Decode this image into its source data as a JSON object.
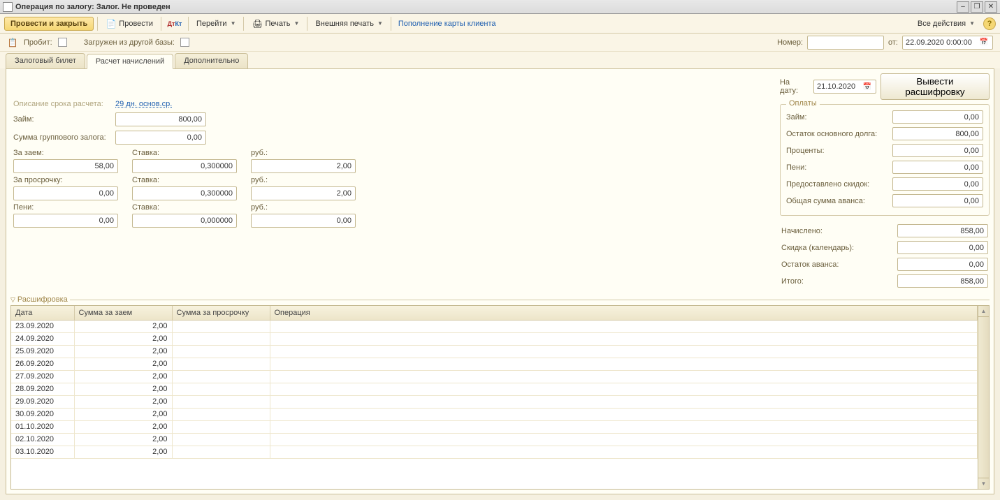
{
  "title": "Операция по залогу: Залог. Не проведен",
  "toolbar": {
    "submit": "Провести и закрыть",
    "post": "Провести",
    "goto": "Перейти",
    "print": "Печать",
    "extprint": "Внешняя печать",
    "cardtopup": "Пополнение карты клиента",
    "allactions": "Все действия"
  },
  "infobar": {
    "probit": "Пробит:",
    "loaded": "Загружен из другой базы:",
    "number_lbl": "Номер:",
    "number_val": "",
    "from_lbl": "от:",
    "from_val": "22.09.2020 0:00:00"
  },
  "tabs": {
    "t1": "Залоговый билет",
    "t2": "Расчет начислений",
    "t3": "Дополнительно"
  },
  "left": {
    "desc_lbl": "Описание срока расчета:",
    "desc_link": "29 дн. основ.ср.",
    "loan_lbl": "Займ:",
    "loan_v": "800,00",
    "group_lbl": "Сумма группового залога:",
    "group_v": "0,00",
    "for_loan": "За заем:",
    "rate": "Ставка:",
    "rub": "руб.:",
    "for_loan_v": "58,00",
    "for_loan_rate": "0,300000",
    "for_loan_rub": "2,00",
    "overdue": "За просрочку:",
    "overdue_v": "0,00",
    "overdue_rate": "0,300000",
    "overdue_rub": "2,00",
    "peni": "Пени:",
    "peni_v": "0,00",
    "peni_rate": "0,000000",
    "peni_rub": "0,00"
  },
  "right": {
    "ondate_lbl": "На дату:",
    "ondate_v": "21.10.2020",
    "decode_btn": "Вывести расшифровку",
    "payments_legend": "Оплаты",
    "p_loan": "Займ:",
    "p_loan_v": "0,00",
    "p_debt": "Остаток основного долга:",
    "p_debt_v": "800,00",
    "p_interest": "Проценты:",
    "p_interest_v": "0,00",
    "p_peni": "Пени:",
    "p_peni_v": "0,00",
    "p_discount": "Предоставлено скидок:",
    "p_discount_v": "0,00",
    "p_advance": "Общая сумма аванса:",
    "p_advance_v": "0,00",
    "t_accrued": "Начислено:",
    "t_accrued_v": "858,00",
    "t_caldisc": "Скидка (календарь):",
    "t_caldisc_v": "0,00",
    "t_advrest": "Остаток аванса:",
    "t_advrest_v": "0,00",
    "t_total": "Итого:",
    "t_total_v": "858,00"
  },
  "detail": {
    "legend": "Расшифровка",
    "cols": {
      "date": "Дата",
      "amt_loan": "Сумма за заем",
      "amt_over": "Сумма за просрочку",
      "op": "Операция"
    },
    "rows": [
      {
        "date": "23.09.2020",
        "a": "2,00",
        "b": "",
        "op": ""
      },
      {
        "date": "24.09.2020",
        "a": "2,00",
        "b": "",
        "op": ""
      },
      {
        "date": "25.09.2020",
        "a": "2,00",
        "b": "",
        "op": ""
      },
      {
        "date": "26.09.2020",
        "a": "2,00",
        "b": "",
        "op": ""
      },
      {
        "date": "27.09.2020",
        "a": "2,00",
        "b": "",
        "op": ""
      },
      {
        "date": "28.09.2020",
        "a": "2,00",
        "b": "",
        "op": ""
      },
      {
        "date": "29.09.2020",
        "a": "2,00",
        "b": "",
        "op": ""
      },
      {
        "date": "30.09.2020",
        "a": "2,00",
        "b": "",
        "op": ""
      },
      {
        "date": "01.10.2020",
        "a": "2,00",
        "b": "",
        "op": ""
      },
      {
        "date": "02.10.2020",
        "a": "2,00",
        "b": "",
        "op": ""
      },
      {
        "date": "03.10.2020",
        "a": "2,00",
        "b": "",
        "op": ""
      }
    ]
  }
}
